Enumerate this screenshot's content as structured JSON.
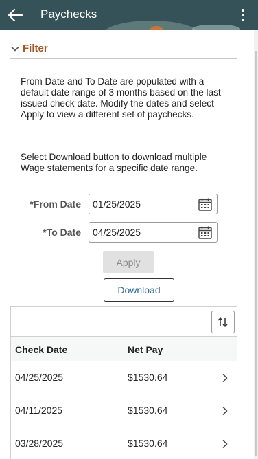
{
  "header": {
    "title": "Paychecks"
  },
  "filter": {
    "label": "Filter",
    "instructions": "From Date and To Date are populated with a default date range of 3 months based on the last issued check date. Modify the dates and select Apply to view a different set of paychecks.",
    "download_hint": "Select Download button to download multiple Wage statements for a specific date range.",
    "from_label": "*From Date",
    "from_value": "01/25/2025",
    "to_label": "*To Date",
    "to_value": "04/25/2025",
    "apply_label": "Apply",
    "download_label": "Download"
  },
  "grid": {
    "columns": [
      "Check Date",
      "Net Pay"
    ],
    "rows": [
      {
        "check_date": "04/25/2025",
        "net_pay": "$1530.64"
      },
      {
        "check_date": "04/11/2025",
        "net_pay": "$1530.64"
      },
      {
        "check_date": "03/28/2025",
        "net_pay": "$1530.64"
      }
    ]
  },
  "icons": {
    "back": "arrow-left-icon",
    "menu": "kebab-menu-icon",
    "filter_toggle": "chevron-down-icon",
    "calendar": "calendar-icon",
    "sort": "sort-icon",
    "row_detail": "chevron-right-icon"
  },
  "colors": {
    "header_bg": "#355259",
    "filter_label": "#a55422",
    "link": "#2a6496"
  }
}
